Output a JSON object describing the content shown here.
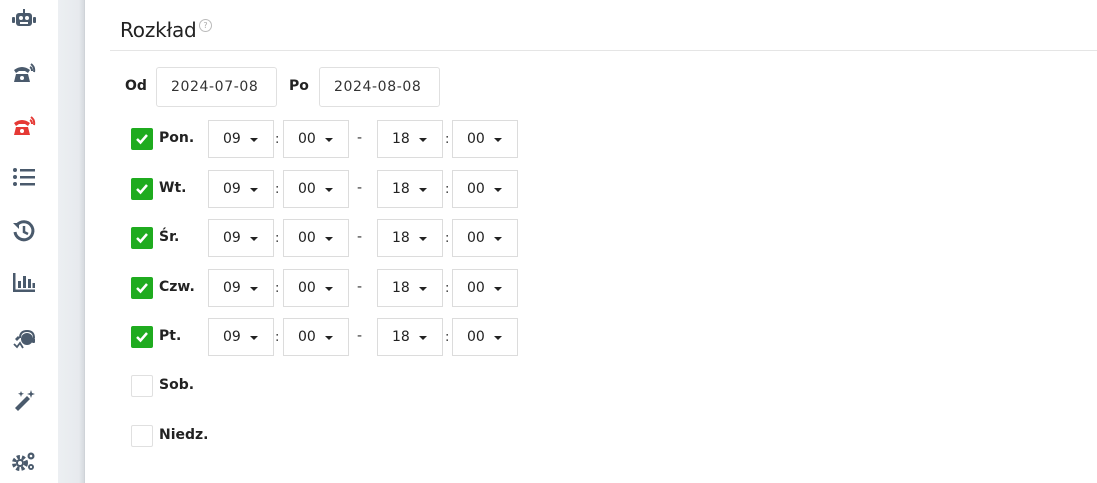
{
  "sidebar": {
    "items": [
      {
        "icon": "robot-icon",
        "color": "#4a5a6c"
      },
      {
        "icon": "phone-incoming-icon",
        "color": "#4a5a6c"
      },
      {
        "icon": "phone-incoming-icon",
        "color": "#e53935"
      },
      {
        "icon": "list-icon",
        "color": "#4a5a6c"
      },
      {
        "icon": "history-icon",
        "color": "#4a5a6c"
      },
      {
        "icon": "bar-chart-icon",
        "color": "#4a5a6c"
      },
      {
        "icon": "agent-headset-icon",
        "color": "#4a5a6c"
      },
      {
        "icon": "magic-wand-icon",
        "color": "#4a5a6c"
      },
      {
        "icon": "gears-icon",
        "color": "#4a5a6c"
      }
    ]
  },
  "section": {
    "title": "Rozkład",
    "help_icon": "help-circle-icon"
  },
  "dates": {
    "from_label": "Od",
    "from_value": "2024-07-08",
    "to_label": "Po",
    "to_value": "2024-08-08"
  },
  "schedule": {
    "colon": ":",
    "dash": "-",
    "days": [
      {
        "label": "Pon.",
        "checked": true,
        "start_h": "09",
        "start_m": "00",
        "end_h": "18",
        "end_m": "00"
      },
      {
        "label": "Wt.",
        "checked": true,
        "start_h": "09",
        "start_m": "00",
        "end_h": "18",
        "end_m": "00"
      },
      {
        "label": "Śr.",
        "checked": true,
        "start_h": "09",
        "start_m": "00",
        "end_h": "18",
        "end_m": "00"
      },
      {
        "label": "Czw.",
        "checked": true,
        "start_h": "09",
        "start_m": "00",
        "end_h": "18",
        "end_m": "00"
      },
      {
        "label": "Pt.",
        "checked": true,
        "start_h": "09",
        "start_m": "00",
        "end_h": "18",
        "end_m": "00"
      },
      {
        "label": "Sob.",
        "checked": false
      },
      {
        "label": "Niedz.",
        "checked": false
      }
    ]
  },
  "colors": {
    "check_green": "#1fab1f",
    "icon_gray": "#4a5a6c",
    "icon_red": "#e53935"
  }
}
